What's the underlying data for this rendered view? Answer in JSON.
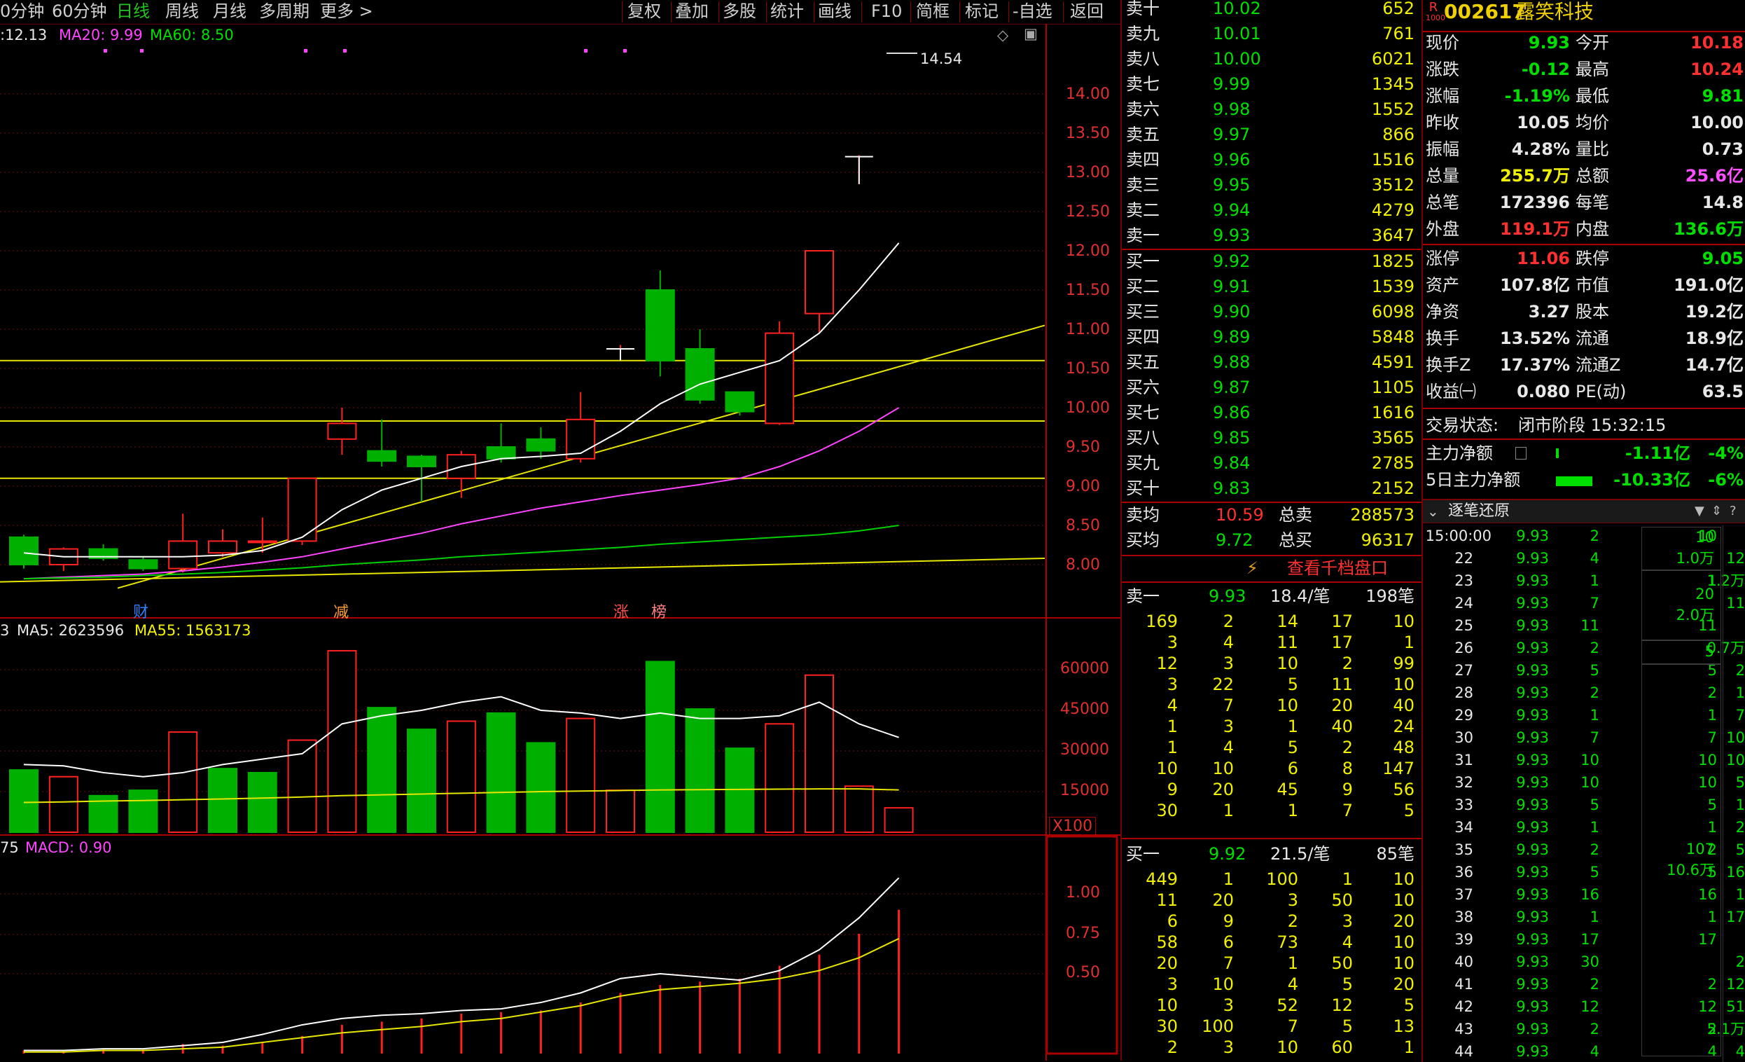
{
  "toolbar": {
    "left": [
      "0分钟",
      "60分钟",
      "日线",
      "周线",
      "月线",
      "多周期",
      "更多 >"
    ],
    "right": [
      "复权",
      "叠加",
      "多股",
      "统计",
      "画线",
      "F10",
      "简框",
      "标记",
      "-自选",
      "返回"
    ]
  },
  "price_panel": {
    "ma_value": ":12.13",
    "ma20": "MA20: 9.99",
    "ma60": "MA60: 8.50",
    "peak_label": "14.54",
    "yticks": [
      "14.00",
      "13.50",
      "13.00",
      "12.50",
      "12.00",
      "11.50",
      "11.00",
      "10.50",
      "10.00",
      "9.50",
      "9.00",
      "8.50",
      "8.00"
    ],
    "markers": [
      "财",
      "减",
      "涨",
      "榜"
    ]
  },
  "volume_panel": {
    "vol_prefix": "3",
    "ma5": "MA5: 2623596",
    "ma55": "MA55: 1563173",
    "yticks": [
      "60000",
      "45000",
      "30000",
      "15000"
    ],
    "unit": "X100"
  },
  "macd_panel": {
    "prefix": "75",
    "macd": "MACD: 0.90",
    "yticks": [
      "1.00",
      "0.75",
      "0.50"
    ]
  },
  "chart_data": {
    "type": "candlestick",
    "candles": [
      {
        "o": 8.35,
        "c": 8.0,
        "h": 8.38,
        "l": 7.95
      },
      {
        "o": 8.0,
        "c": 8.2,
        "h": 8.22,
        "l": 7.92
      },
      {
        "o": 8.2,
        "c": 8.08,
        "h": 8.26,
        "l": 8.05
      },
      {
        "o": 8.06,
        "c": 7.95,
        "h": 8.1,
        "l": 7.92
      },
      {
        "o": 7.95,
        "c": 8.3,
        "h": 8.65,
        "l": 7.9
      },
      {
        "o": 8.15,
        "c": 8.3,
        "h": 8.45,
        "l": 8.1
      },
      {
        "o": 8.3,
        "c": 8.3,
        "h": 8.6,
        "l": 8.15
      },
      {
        "o": 8.3,
        "c": 9.1,
        "h": 9.1,
        "l": 8.25
      },
      {
        "o": 9.6,
        "c": 9.8,
        "h": 10.0,
        "l": 9.4
      },
      {
        "o": 9.45,
        "c": 9.32,
        "h": 9.85,
        "l": 9.25
      },
      {
        "o": 9.38,
        "c": 9.25,
        "h": 9.4,
        "l": 8.8
      },
      {
        "o": 9.1,
        "c": 9.4,
        "h": 9.45,
        "l": 8.85
      },
      {
        "o": 9.5,
        "c": 9.35,
        "h": 9.8,
        "l": 9.3
      },
      {
        "o": 9.6,
        "c": 9.45,
        "h": 9.75,
        "l": 9.35
      },
      {
        "o": 9.35,
        "c": 9.85,
        "h": 10.2,
        "l": 9.3
      },
      {
        "o": 10.75,
        "c": 10.75,
        "h": 10.8,
        "l": 10.6
      },
      {
        "o": 11.5,
        "c": 10.6,
        "h": 11.75,
        "l": 10.4
      },
      {
        "o": 10.75,
        "c": 10.1,
        "h": 11.0,
        "l": 10.05
      },
      {
        "o": 10.2,
        "c": 9.95,
        "h": 10.2,
        "l": 9.9
      },
      {
        "o": 9.8,
        "c": 10.95,
        "h": 11.1,
        "l": 9.78
      },
      {
        "o": 11.2,
        "c": 12.0,
        "h": 12.0,
        "l": 10.95
      },
      {
        "o": 13.2,
        "c": 13.2,
        "h": 13.22,
        "l": 12.85
      }
    ],
    "volume": {
      "values": [
        23000,
        20500,
        13500,
        15500,
        37000,
        23500,
        22000,
        34000,
        67000,
        46000,
        38000,
        41000,
        44000,
        33000,
        42000,
        15500,
        63000,
        45500,
        31000,
        40000,
        58000,
        17000,
        9000
      ],
      "colors": [
        "g",
        "r",
        "g",
        "g",
        "r",
        "g",
        "g",
        "r",
        "r",
        "g",
        "g",
        "r",
        "g",
        "g",
        "r",
        "r",
        "g",
        "g",
        "g",
        "r",
        "r",
        "r",
        "r"
      ]
    },
    "macd": [
      0.02,
      0.02,
      0.03,
      0.03,
      0.06,
      0.05,
      0.07,
      0.11,
      0.18,
      0.2,
      0.22,
      0.25,
      0.26,
      0.27,
      0.32,
      0.38,
      0.43,
      0.45,
      0.47,
      0.55,
      0.62,
      0.75,
      0.9
    ]
  },
  "quote": {
    "code": "002617",
    "name": "露笑科技",
    "badge": "R",
    "badge_sub": "1000",
    "sell": [
      {
        "label": "卖十",
        "price": "10.02",
        "vol": "652"
      },
      {
        "label": "卖九",
        "price": "10.01",
        "vol": "761"
      },
      {
        "label": "卖八",
        "price": "10.00",
        "vol": "6021"
      },
      {
        "label": "卖七",
        "price": "9.99",
        "vol": "1345"
      },
      {
        "label": "卖六",
        "price": "9.98",
        "vol": "1552"
      },
      {
        "label": "卖五",
        "price": "9.97",
        "vol": "866"
      },
      {
        "label": "卖四",
        "price": "9.96",
        "vol": "1516"
      },
      {
        "label": "卖三",
        "price": "9.95",
        "vol": "3512"
      },
      {
        "label": "卖二",
        "price": "9.94",
        "vol": "4279"
      },
      {
        "label": "卖一",
        "price": "9.93",
        "vol": "3647"
      }
    ],
    "buy": [
      {
        "label": "买一",
        "price": "9.92",
        "vol": "1825"
      },
      {
        "label": "买二",
        "price": "9.91",
        "vol": "1539"
      },
      {
        "label": "买三",
        "price": "9.90",
        "vol": "6098"
      },
      {
        "label": "买四",
        "price": "9.89",
        "vol": "5848"
      },
      {
        "label": "买五",
        "price": "9.88",
        "vol": "4591"
      },
      {
        "label": "买六",
        "price": "9.87",
        "vol": "1105"
      },
      {
        "label": "买七",
        "price": "9.86",
        "vol": "1616"
      },
      {
        "label": "买八",
        "price": "9.85",
        "vol": "3565"
      },
      {
        "label": "买九",
        "price": "9.84",
        "vol": "2785"
      },
      {
        "label": "买十",
        "price": "9.83",
        "vol": "2152"
      }
    ],
    "avg_sell_label": "卖均",
    "avg_sell": "10.59",
    "total_sell_label": "总卖",
    "total_sell": "288573",
    "avg_buy_label": "买均",
    "avg_buy": "9.72",
    "total_buy_label": "总买",
    "total_buy": "96317",
    "view_thousand": "查看千档盘口"
  },
  "stats": [
    [
      "现价",
      "9.93",
      "今开",
      "10.18"
    ],
    [
      "涨跌",
      "-0.12",
      "最高",
      "10.24"
    ],
    [
      "涨幅",
      "-1.19%",
      "最低",
      "9.81"
    ],
    [
      "昨收",
      "10.05",
      "均价",
      "10.00"
    ],
    [
      "振幅",
      "4.28%",
      "量比",
      "0.73"
    ],
    [
      "总量",
      "255.7万",
      "总额",
      "25.6亿"
    ],
    [
      "总笔",
      "172396",
      "每笔",
      "14.8"
    ],
    [
      "外盘",
      "119.1万",
      "内盘",
      "136.6万"
    ],
    [
      "涨停",
      "11.06",
      "跌停",
      "9.05"
    ],
    [
      "资产",
      "107.8亿",
      "市值",
      "191.0亿"
    ],
    [
      "净资",
      "3.27",
      "股本",
      "19.2亿"
    ],
    [
      "换手",
      "13.52%",
      "流通",
      "18.9亿"
    ],
    [
      "换手Z",
      "17.37%",
      "流通Z",
      "14.7亿"
    ],
    [
      "收益㈠",
      "0.080",
      "PE(动)",
      "63.5"
    ]
  ],
  "trade_status": {
    "label": "交易状态:",
    "value": "闭市阶段 15:32:15"
  },
  "main_flow": [
    {
      "label": "主力净额",
      "value": "-1.11亿",
      "pct": "-4%"
    },
    {
      "label": "5日主力净额",
      "value": "-10.33亿",
      "pct": "-6%"
    }
  ],
  "queue_sell": {
    "label": "卖一",
    "price": "9.93",
    "per": "18.4/笔",
    "count": "198笔",
    "rows": [
      [
        "169",
        "2",
        "14",
        "17",
        "10"
      ],
      [
        "3",
        "4",
        "11",
        "17",
        "1"
      ],
      [
        "12",
        "3",
        "10",
        "2",
        "99"
      ],
      [
        "3",
        "22",
        "5",
        "11",
        "10"
      ],
      [
        "4",
        "7",
        "10",
        "20",
        "40"
      ],
      [
        "1",
        "3",
        "1",
        "40",
        "24"
      ],
      [
        "1",
        "4",
        "5",
        "2",
        "48"
      ],
      [
        "10",
        "10",
        "6",
        "8",
        "147"
      ],
      [
        "9",
        "20",
        "45",
        "9",
        "56"
      ],
      [
        "30",
        "1",
        "1",
        "7",
        "5"
      ]
    ]
  },
  "queue_buy": {
    "label": "买一",
    "price": "9.92",
    "per": "21.5/笔",
    "count": "85笔",
    "rows": [
      [
        "449",
        "1",
        "100",
        "1",
        "10"
      ],
      [
        "11",
        "20",
        "3",
        "50",
        "10"
      ],
      [
        "6",
        "9",
        "2",
        "3",
        "20"
      ],
      [
        "58",
        "6",
        "73",
        "4",
        "10"
      ],
      [
        "20",
        "7",
        "1",
        "50",
        "10"
      ],
      [
        "3",
        "10",
        "4",
        "5",
        "20"
      ],
      [
        "10",
        "3",
        "52",
        "12",
        "5"
      ],
      [
        "30",
        "100",
        "7",
        "5",
        "13"
      ],
      [
        "2",
        "3",
        "10",
        "60",
        "1"
      ]
    ]
  },
  "ticks": {
    "title": "逐笔还原",
    "rows": [
      [
        "15:00:00",
        "9.93",
        "2",
        "10"
      ],
      [
        "22",
        "9.93",
        "4",
        ""
      ],
      [
        "23",
        "9.93",
        "1",
        "1"
      ],
      [
        "24",
        "9.93",
        "7",
        ""
      ],
      [
        "25",
        "9.93",
        "11",
        "11"
      ],
      [
        "26",
        "9.93",
        "2",
        ""
      ],
      [
        "27",
        "9.93",
        "5",
        "5"
      ],
      [
        "28",
        "9.93",
        "2",
        "2"
      ],
      [
        "29",
        "9.93",
        "1",
        "1"
      ],
      [
        "30",
        "9.93",
        "7",
        "7"
      ],
      [
        "31",
        "9.93",
        "10",
        "10"
      ],
      [
        "32",
        "9.93",
        "10",
        "10"
      ],
      [
        "33",
        "9.93",
        "5",
        "5"
      ],
      [
        "34",
        "9.93",
        "1",
        "1"
      ],
      [
        "35",
        "9.93",
        "2",
        "2"
      ],
      [
        "36",
        "9.93",
        "5",
        "5"
      ],
      [
        "37",
        "9.93",
        "16",
        "16"
      ],
      [
        "38",
        "9.93",
        "1",
        "1"
      ],
      [
        "39",
        "9.93",
        "17",
        "17"
      ],
      [
        "40",
        "9.93",
        "30",
        ""
      ],
      [
        "41",
        "9.93",
        "2",
        "2"
      ],
      [
        "42",
        "9.93",
        "12",
        "12"
      ],
      [
        "43",
        "9.93",
        "2",
        "2"
      ],
      [
        "44",
        "9.93",
        "4",
        "4"
      ]
    ],
    "boxes": [
      {
        "a": "10",
        "b": "1.0万"
      },
      {
        "a": "20",
        "b": "2.0万"
      },
      {
        "a": "5",
        "b": ""
      },
      {
        "a": "107",
        "b": "10.6万"
      }
    ],
    "right_col": [
      "",
      "12",
      "1.2万",
      "11",
      "",
      "0.7万",
      "2",
      "1",
      "7",
      "10",
      "10",
      "5",
      "1",
      "2",
      "5",
      "16",
      "1",
      "17",
      "",
      "2",
      "12",
      "51",
      "5.1万",
      "4"
    ]
  }
}
